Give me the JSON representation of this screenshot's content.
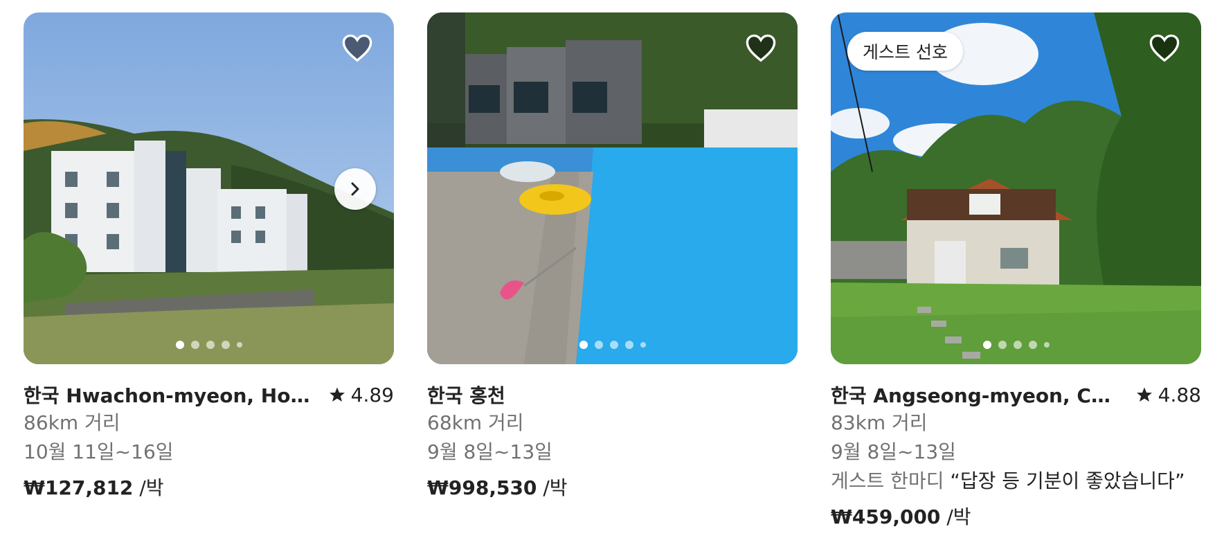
{
  "listings": [
    {
      "title": "한국 Hwachon-myeon, Hong...",
      "rating": "4.89",
      "distance": "86km 거리",
      "dates": "10월 11일~16일",
      "price": "₩127,812",
      "per_night": " /박",
      "wishlist_icon": "heart-icon",
      "photo_count": 5,
      "active_photo": 1
    },
    {
      "title": "한국 홍천",
      "distance": "68km 거리",
      "dates": "9월 8일~13일",
      "price": "₩998,530",
      "per_night": " /박",
      "wishlist_icon": "heart-icon",
      "photo_count": 5,
      "active_photo": 1
    },
    {
      "title": "한국 Angseong-myeon, Cheo...",
      "rating": "4.88",
      "badge": "게스트 선호",
      "distance": "83km 거리",
      "dates": "9월 8일~13일",
      "review_label": "게스트 한마디 ",
      "review_quote": "“답장 등 기분이 좋았습니다”",
      "price": "₩459,000",
      "per_night": " /박",
      "wishlist_icon": "heart-icon",
      "photo_count": 5,
      "active_photo": 1
    }
  ],
  "colors": {
    "text_primary": "#222222",
    "text_secondary": "#717171",
    "heart_fill_first": "#4a5a72",
    "heart_fill_other": "rgba(0,0,0,0.45)"
  }
}
